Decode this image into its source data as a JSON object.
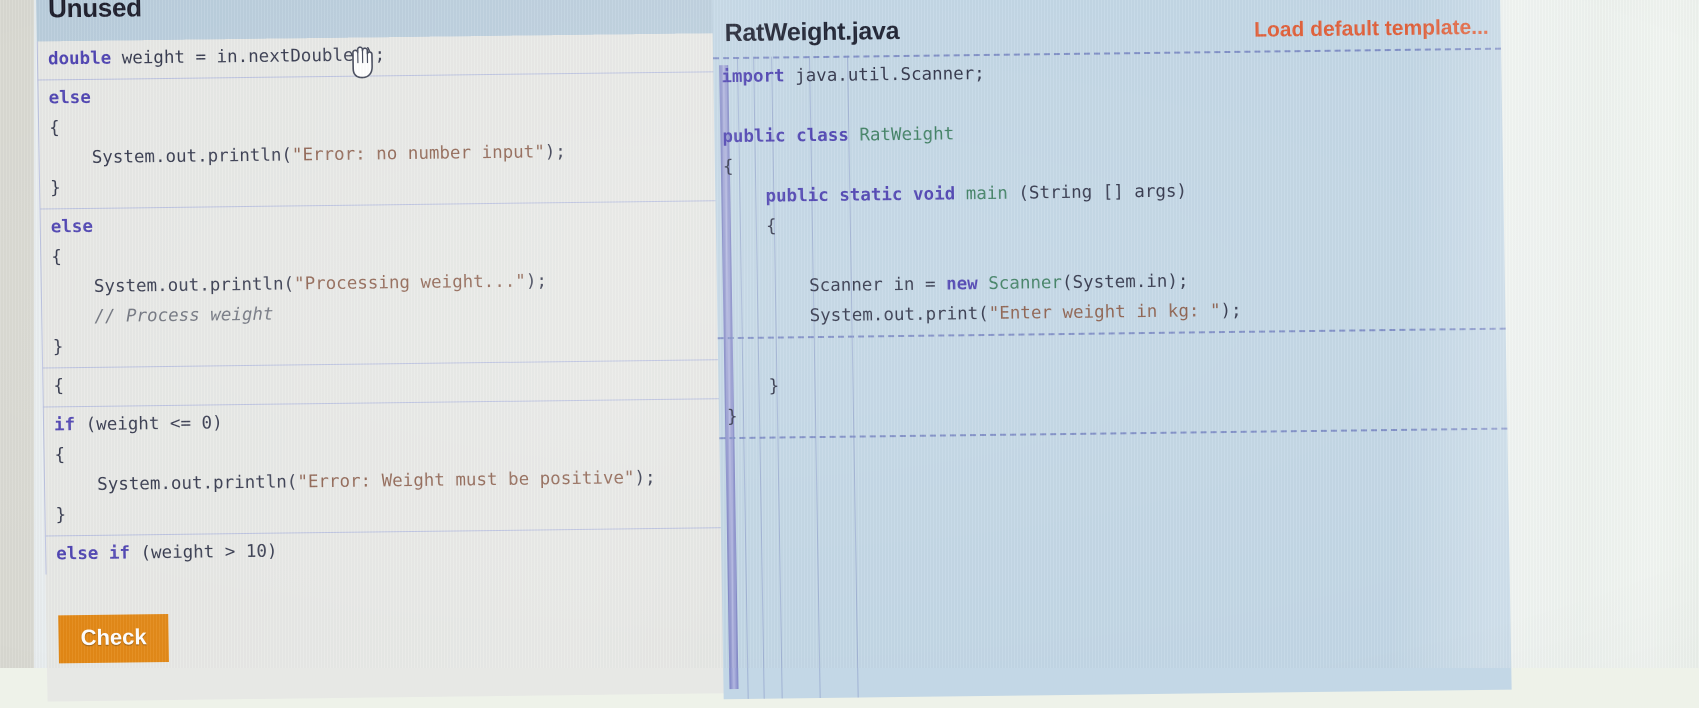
{
  "left_panel": {
    "title": "Unused",
    "blocks": [
      {
        "id": "u1",
        "lines": [
          [
            {
              "t": "double",
              "c": "kw"
            },
            {
              "t": " weight = ",
              "c": "pln"
            },
            {
              "t": "in.nextDouble();",
              "c": "pln"
            }
          ]
        ]
      },
      {
        "id": "u2",
        "lines": [
          [
            {
              "t": "else",
              "c": "kw"
            }
          ],
          [
            {
              "t": "{",
              "c": "pun"
            }
          ],
          [
            {
              "t": "    System.out.println(",
              "c": "pln"
            },
            {
              "t": "\"Error: no number input\"",
              "c": "str"
            },
            {
              "t": ");",
              "c": "pln"
            }
          ],
          [
            {
              "t": "}",
              "c": "pun"
            }
          ]
        ]
      },
      {
        "id": "u3",
        "lines": [
          [
            {
              "t": "else",
              "c": "kw"
            }
          ],
          [
            {
              "t": "{",
              "c": "pun"
            }
          ],
          [
            {
              "t": "    System.out.println(",
              "c": "pln"
            },
            {
              "t": "\"Processing weight...\"",
              "c": "str"
            },
            {
              "t": ");",
              "c": "pln"
            }
          ],
          [
            {
              "t": "    // Process weight",
              "c": "cmt"
            }
          ],
          [
            {
              "t": "}",
              "c": "pun"
            }
          ]
        ]
      },
      {
        "id": "u4",
        "lines": [
          [
            {
              "t": "{",
              "c": "pun"
            }
          ]
        ]
      },
      {
        "id": "u5",
        "lines": [
          [
            {
              "t": "if",
              "c": "kw"
            },
            {
              "t": " (weight <= ",
              "c": "pln"
            },
            {
              "t": "0",
              "c": "num"
            },
            {
              "t": ")",
              "c": "pln"
            }
          ],
          [
            {
              "t": "{",
              "c": "pun"
            }
          ],
          [
            {
              "t": "    System.out.println(",
              "c": "pln"
            },
            {
              "t": "\"Error: Weight must be positive\"",
              "c": "str"
            },
            {
              "t": ");",
              "c": "pln"
            }
          ],
          [
            {
              "t": "}",
              "c": "pun"
            }
          ]
        ]
      },
      {
        "id": "u6",
        "lines": [
          [
            {
              "t": "else",
              "c": "kw"
            },
            {
              "t": " ",
              "c": "pln"
            },
            {
              "t": "if",
              "c": "kw"
            },
            {
              "t": " (weight > ",
              "c": "pln"
            },
            {
              "t": "10",
              "c": "num"
            },
            {
              "t": ")",
              "c": "pln"
            }
          ]
        ]
      }
    ],
    "check_button_label": "Check",
    "scrollbar": {
      "visible": true
    }
  },
  "right_panel": {
    "title": "RatWeight.java",
    "load_default_template_label": "Load default template...",
    "blocks": [
      {
        "id": "s1",
        "lines": [
          [
            {
              "t": "import",
              "c": "kw"
            },
            {
              "t": " java.util.Scanner;",
              "c": "pln"
            }
          ],
          [
            {
              "t": "",
              "c": "pln"
            }
          ],
          [
            {
              "t": "public",
              "c": "kw"
            },
            {
              "t": " ",
              "c": "pln"
            },
            {
              "t": "class",
              "c": "kw"
            },
            {
              "t": " ",
              "c": "pln"
            },
            {
              "t": "RatWeight",
              "c": "typ"
            }
          ],
          [
            {
              "t": "{",
              "c": "pun"
            }
          ],
          [
            {
              "t": "    ",
              "c": "pln"
            },
            {
              "t": "public",
              "c": "kw"
            },
            {
              "t": " ",
              "c": "pln"
            },
            {
              "t": "static",
              "c": "kw"
            },
            {
              "t": " ",
              "c": "pln"
            },
            {
              "t": "void",
              "c": "kw"
            },
            {
              "t": " ",
              "c": "pln"
            },
            {
              "t": "main",
              "c": "typ"
            },
            {
              "t": " (String [] args)",
              "c": "pln"
            }
          ],
          [
            {
              "t": "    {",
              "c": "pun"
            }
          ],
          [
            {
              "t": "",
              "c": "pln"
            }
          ],
          [
            {
              "t": "        Scanner in = ",
              "c": "pln"
            },
            {
              "t": "new",
              "c": "kw"
            },
            {
              "t": " ",
              "c": "pln"
            },
            {
              "t": "Scanner",
              "c": "typ"
            },
            {
              "t": "(System.in);",
              "c": "pln"
            }
          ],
          [
            {
              "t": "        System.out.print(",
              "c": "pln"
            },
            {
              "t": "\"Enter weight in kg: \"",
              "c": "str"
            },
            {
              "t": ");",
              "c": "pln"
            }
          ]
        ]
      },
      {
        "id": "s2",
        "lines": [
          [
            {
              "t": "",
              "c": "pln"
            }
          ],
          [
            {
              "t": "    }",
              "c": "pun"
            }
          ],
          [
            {
              "t": "}",
              "c": "pun"
            }
          ]
        ]
      },
      {
        "id": "s3",
        "lines": [
          [
            {
              "t": "",
              "c": "pln"
            }
          ],
          [
            {
              "t": "",
              "c": "pln"
            }
          ]
        ]
      }
    ]
  },
  "cursor": {
    "icon": "grab-hand-cursor"
  },
  "colors": {
    "accent_orange": "#e2850f",
    "link_orange": "#e0603a",
    "panel_blue": "#c3d7e6",
    "header_blue": "#b9cddc",
    "unused_bg": "#e7e8e5",
    "keyword": "#4a3fb0",
    "string": "#8a5d4a",
    "type": "#3b7d60",
    "comment": "#6b6f7a",
    "scrollbar": "#7e83bf"
  }
}
